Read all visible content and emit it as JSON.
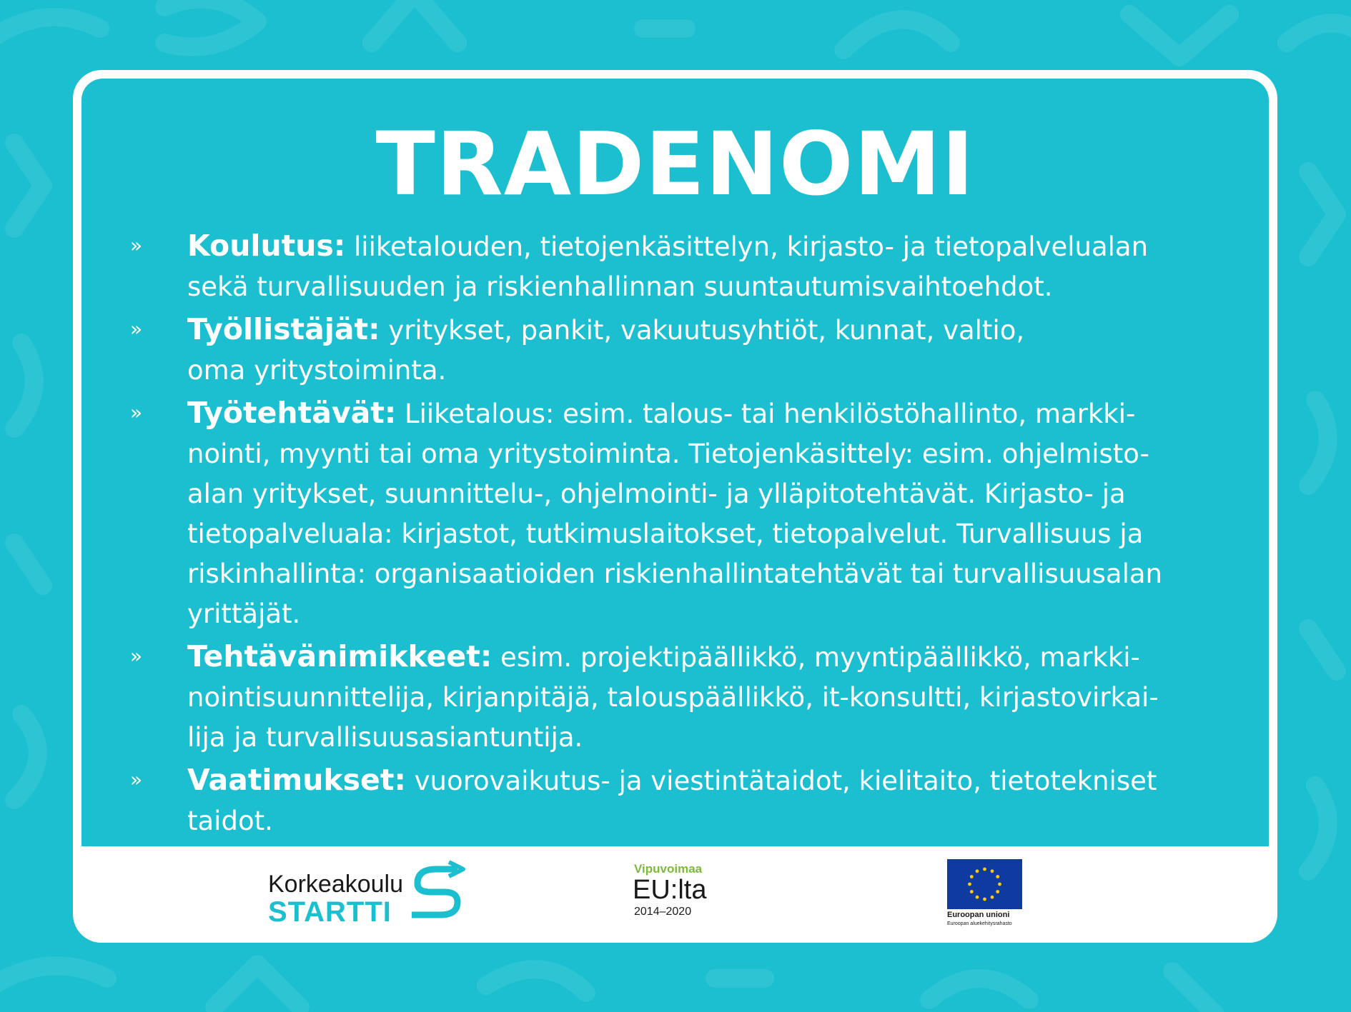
{
  "title": "TRADENOMI",
  "items": [
    {
      "label": "Koulutus:",
      "text": " liiketalouden, tietojenkäsittelyn, kirjasto- ja tietopalvelualan\nsekä turvallisuuden ja riskienhallinnan suuntautumisvaihtoehdot."
    },
    {
      "label": "Työllistäjät:",
      "text": " yritykset, pankit, vakuutusyhtiöt, kunnat, valtio,\noma yritystoiminta."
    },
    {
      "label": "Työtehtävät:",
      "text": " Liiketalous: esim. talous- tai henkilöstöhallinto, markki-\nnointi, myynti tai oma yritystoiminta. Tietojenkäsittely: esim. ohjelmisto-\nalan yritykset, suunnittelu-, ohjelmointi- ja ylläpitotehtävät. Kirjasto- ja\ntietopalveluala: kirjastot, tutkimuslaitokset, tietopalvelut. Turvallisuus ja\nriskinhallinta: organisaatioiden riskienhallintatehtävät tai turvallisuusalan\nyrittäjät."
    },
    {
      "label": "Tehtävänimikkeet:",
      "text": " esim. projektipäällikkö, myyntipäällikkö, markki-\nnointisuunnittelija, kirjanpitäjä, talouspäällikkö, it-konsultti, kirjastovirkai-\nlija ja turvallisuusasiantuntija."
    },
    {
      "label": "Vaatimukset:",
      "text": " vuorovaikutus- ja viestintätaidot, kielitaito, tietotekniset\ntaidot."
    }
  ],
  "bullet_glyph": "»",
  "footer": {
    "korkeakoulu_word": "Korkeakoulu",
    "startti_word": "STARTTI",
    "vipuvoimaa": "Vipuvoimaa",
    "eu_lta": "EU:lta",
    "years": "2014–2020",
    "eu_name": "Euroopan unioni",
    "eu_fund": "Euroopan aluekehitysrahasto"
  },
  "colors": {
    "background": "#1cbfcf",
    "text": "#ffffff",
    "accent_green": "#7cba3c",
    "eu_blue": "#0f3aa0",
    "eu_gold": "#ffcc00"
  }
}
